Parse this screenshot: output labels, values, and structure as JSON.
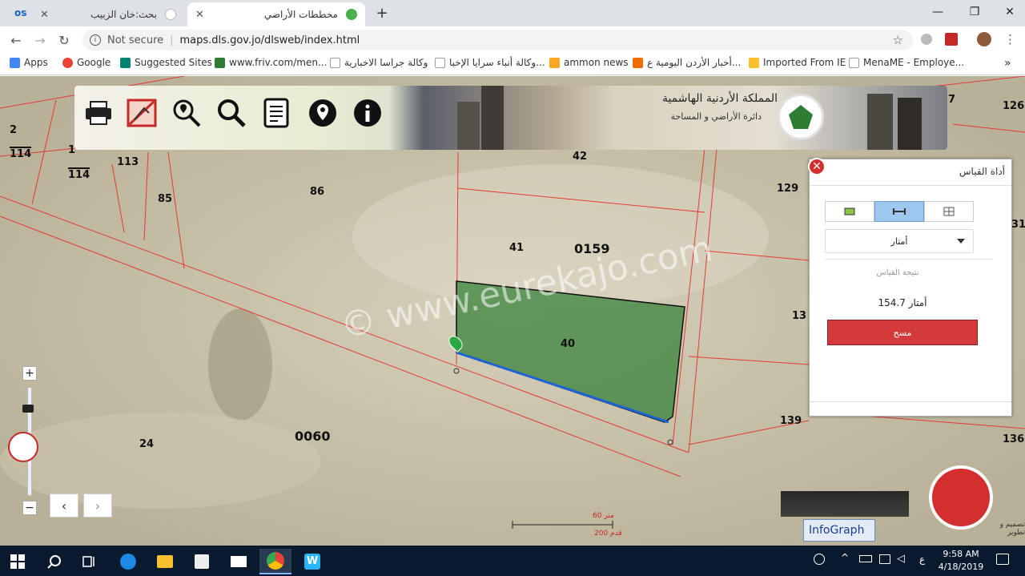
{
  "browser": {
    "tabs": [
      {
        "title": "بحث:خان الزبيب",
        "active": false
      },
      {
        "title": "مخططات الأراضي",
        "active": true
      }
    ],
    "tab_logo": "os",
    "new_tab_icon": "plus-icon",
    "security_label": "Not secure",
    "url": "maps.dls.gov.jo/dlsweb/index.html",
    "bookmarks": [
      {
        "label": "Apps",
        "icon": "apps-grid-icon",
        "color": "#4285f4"
      },
      {
        "label": "Google",
        "icon": "google-icon",
        "color": "#ea4335"
      },
      {
        "label": "Suggested Sites",
        "icon": "bing-icon",
        "color": "#008373"
      },
      {
        "label": "www.friv.com/men...",
        "icon": "friv-icon",
        "color": "#2e7d32"
      },
      {
        "label": "وكالة جراسا الاخبارية",
        "icon": "page-icon",
        "color": "#9e9e9e"
      },
      {
        "label": "وكالة أنباء سرايا الإخبا...",
        "icon": "page-icon",
        "color": "#9e9e9e"
      },
      {
        "label": "ammon news",
        "icon": "ammon-icon",
        "color": "#f9a825"
      },
      {
        "label": "أخبار الأردن اليومية ع...",
        "icon": "rss-icon",
        "color": "#ef6c00"
      },
      {
        "label": "Imported From IE",
        "icon": "folder-icon",
        "color": "#fbc02d"
      },
      {
        "label": "MenaME - Employe...",
        "icon": "page-icon",
        "color": "#9e9e9e"
      }
    ],
    "more_bookmarks": "»"
  },
  "map": {
    "parcel_labels": [
      {
        "text": "2"
      },
      {
        "text": "114"
      },
      {
        "text": "1"
      },
      {
        "text": "114"
      },
      {
        "text": "113"
      },
      {
        "text": "85"
      },
      {
        "text": "86"
      },
      {
        "text": "42"
      },
      {
        "text": "129"
      },
      {
        "text": "7"
      },
      {
        "text": "126"
      },
      {
        "text": "41"
      },
      {
        "text": "0159"
      },
      {
        "text": "40"
      },
      {
        "text": "13"
      },
      {
        "text": "139"
      },
      {
        "text": "136"
      },
      {
        "text": "24"
      },
      {
        "text": "0060"
      },
      {
        "text": "31"
      }
    ],
    "watermark": "© www.eurekajo.com",
    "scale": {
      "top": "60 متر",
      "bottom": "200 قدم"
    }
  },
  "header": {
    "kingdom": "المملكة الأردنية الهاشمية",
    "department": "دائرة الأراضي و المساحة",
    "tools": [
      {
        "name": "print-icon"
      },
      {
        "name": "clear-map-icon"
      },
      {
        "name": "locate-search-icon"
      },
      {
        "name": "search-icon"
      },
      {
        "name": "document-icon"
      },
      {
        "name": "location-pin-icon"
      },
      {
        "name": "info-icon"
      }
    ]
  },
  "measure_panel": {
    "title": "أداة القياس",
    "unit": "أمتار",
    "result_label": "نتيجة القياس",
    "result_value": "154.7",
    "result_unit": "أمتار",
    "clear_button": "مسح",
    "modes": [
      "area-tool-icon",
      "distance-tool-icon",
      "location-tool-icon"
    ],
    "selected_mode": 1
  },
  "branding": {
    "infograph": "InfoGraph",
    "tagline": "تصميم و تطوير"
  },
  "taskbar": {
    "time": "9:58 AM",
    "date": "4/18/2019",
    "lang": "ع"
  }
}
